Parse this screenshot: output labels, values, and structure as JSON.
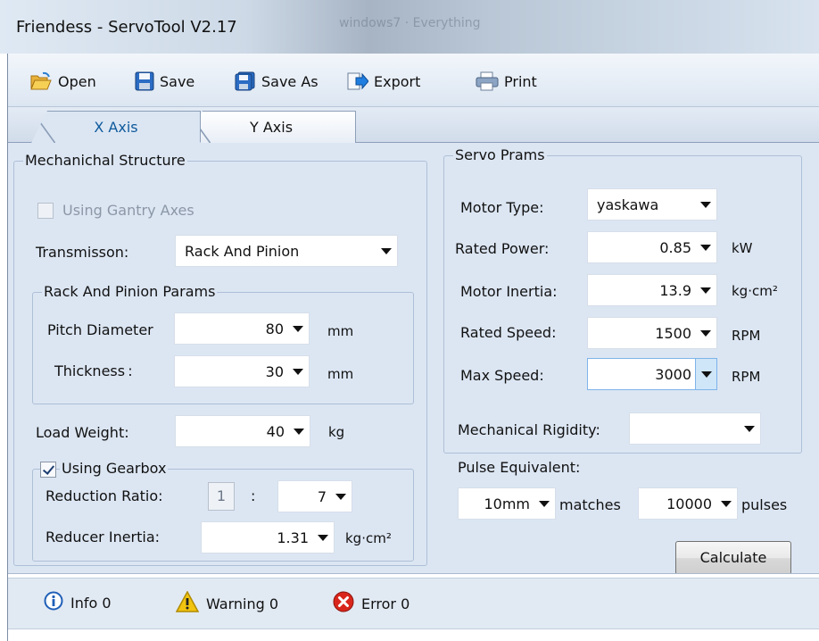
{
  "window": {
    "title": "Friendess - ServoTool V2.17",
    "background_title": "windows7 · Everything"
  },
  "toolbar": {
    "open": "Open",
    "save": "Save",
    "save_as": "Save As",
    "export": "Export",
    "print": "Print"
  },
  "tabs": [
    {
      "label": "X Axis",
      "active": true
    },
    {
      "label": "Y Axis",
      "active": false
    }
  ],
  "mechanical": {
    "title": "Mechanichal Structure",
    "gantry_label": "Using Gantry Axes",
    "gantry_checked": false,
    "transmission_label": "Transmisson:",
    "transmission_value": "Rack And Pinion",
    "rack_group_title": "Rack And Pinion Params",
    "pitch_label": "Pitch Diameter",
    "pitch_value": "80",
    "pitch_unit": "mm",
    "thickness_label": "Thickness :",
    "thickness_value": "30",
    "thickness_unit": "mm",
    "load_label": "Load Weight:",
    "load_value": "40",
    "load_unit": "kg",
    "gearbox_label": "Using Gearbox",
    "gearbox_checked": true,
    "reduction_label": "Reduction Ratio:",
    "reduction_left": "1",
    "reduction_colon": ":",
    "reduction_right": "7",
    "reducer_inertia_label": "Reducer Inertia:",
    "reducer_inertia_value": "1.31",
    "reducer_inertia_unit": "kg·cm²"
  },
  "servo": {
    "title": "Servo Prams",
    "motor_type_label": "Motor Type:",
    "motor_type_value": "yaskawa",
    "rated_power_label": "Rated Power:",
    "rated_power_value": "0.85",
    "rated_power_unit": "kW",
    "motor_inertia_label": "Motor Inertia:",
    "motor_inertia_value": "13.9",
    "motor_inertia_unit": "kg·cm²",
    "rated_speed_label": "Rated Speed:",
    "rated_speed_value": "1500",
    "rated_speed_unit": "RPM",
    "max_speed_label": "Max Speed:",
    "max_speed_value": "3000",
    "max_speed_unit": "RPM"
  },
  "calc": {
    "rigidity_label": "Mechanical Rigidity:",
    "rigidity_value": "",
    "pulse_label": "Pulse Equivalent:",
    "pulse_mm_value": "10mm",
    "matches_label": "matches",
    "pulse_count_value": "10000",
    "pulses_label": "pulses",
    "calculate_label": "Calculate"
  },
  "status": {
    "info": "Info 0",
    "warning": "Warning 0",
    "error": "Error 0"
  },
  "colors": {
    "panel_bg": "#dce6f3",
    "active_tab_text": "#0f5a9c",
    "error_red": "#d9261c",
    "warning_yellow": "#f2c40f",
    "info_blue": "#1f5fb8"
  }
}
